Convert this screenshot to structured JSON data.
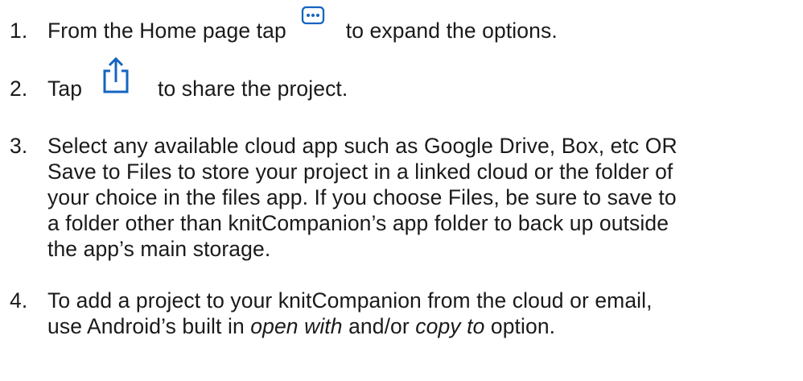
{
  "steps": [
    {
      "number": "1.",
      "text_before_icon": "From the Home page tap",
      "icon": "more-options-icon",
      "text_after_icon": "to expand the options."
    },
    {
      "number": "2.",
      "text_before_icon": "Tap",
      "icon": "share-icon",
      "text_after_icon": "to share the project."
    },
    {
      "number": "3.",
      "lines": [
        "Select any available cloud app such as Google Drive, Box, etc OR",
        "Save to Files to store your project in a linked cloud or the folder of",
        "your choice in the files app. If you choose Files, be sure to save to",
        "a folder other than knitCompanion’s app folder to back up outside",
        "the app’s main storage."
      ]
    },
    {
      "number": "4.",
      "line1": "To add a project to your knitCompanion from the cloud or email,",
      "line2_part1": "use Android’s built in ",
      "line2_em1": "open with",
      "line2_part2": " and/or ",
      "line2_em2": "copy to",
      "line2_part3": " option."
    }
  ],
  "colors": {
    "text": "#1a1a1a",
    "icon": "#1565c0"
  }
}
